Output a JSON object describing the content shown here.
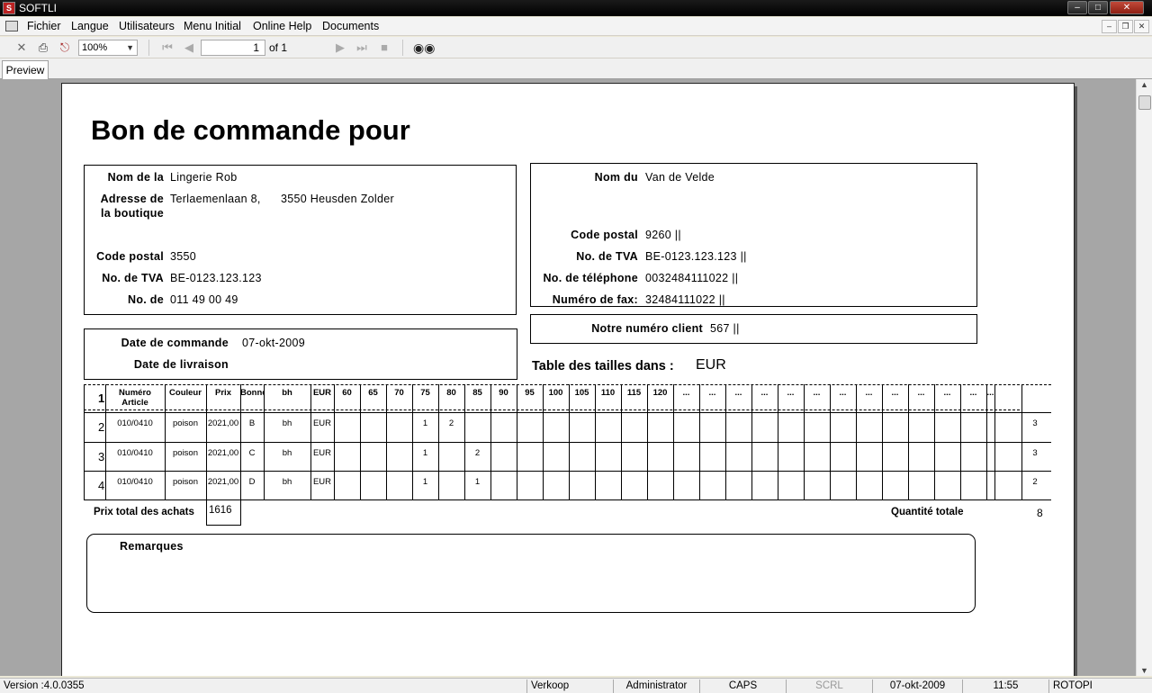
{
  "window": {
    "title": "SOFTLI",
    "app_icon": "S",
    "controls": {
      "minimize": "minimize-icon",
      "maximize": "maximize-icon",
      "close": "close-icon"
    }
  },
  "menubar": {
    "items": [
      "Fichier",
      "Langue",
      "Utilisateurs",
      "Menu Initial",
      "Online Help",
      "Documents"
    ]
  },
  "toolbar": {
    "zoom": "100%",
    "page": "1",
    "of": "of 1",
    "icons": [
      "close-icon",
      "print-icon",
      "export-icon",
      "first-page-icon",
      "prev-page-icon",
      "next-page-icon",
      "last-page-icon",
      "stop-icon",
      "binoculars-icon"
    ]
  },
  "tabs": [
    "Preview"
  ],
  "document": {
    "title": "Bon de commande pour",
    "shop": {
      "name_label": "Nom de la",
      "name": "Lingerie Rob",
      "address_label_1": "Adresse de",
      "address_label_2": "la boutique",
      "address": "Terlaemenlaan 8,",
      "address_city": "3550 Heusden Zolder",
      "postal_label": "Code postal",
      "postal": "3550",
      "vat_label": "No. de TVA",
      "vat": "BE-0123.123.123",
      "phone_label": "No. de",
      "phone": "011 49 00 49"
    },
    "supplier": {
      "name_label": "Nom du",
      "name": "Van de Velde",
      "postal_label": "Code postal",
      "postal": "9260 ||",
      "vat_label": "No. de TVA",
      "vat": "BE-0123.123.123 ||",
      "phone_label": "No. de téléphone",
      "phone": "0032484111022 ||",
      "fax_label": "Numéro de fax:",
      "fax": "32484111022 ||"
    },
    "order": {
      "date_label": "Date de commande",
      "date": "07-okt-2009",
      "delivery_label": "Date de livraison",
      "delivery": ""
    },
    "client": {
      "label": "Notre numéro client",
      "number": "567 ||"
    },
    "sizes_title": "Table des tailles dans :",
    "sizes_unit": "EUR",
    "grid": {
      "header_row_number": "1",
      "headers": [
        "Numéro Article",
        "Couleur",
        "Prix",
        "Bonnet",
        "bh",
        "EUR",
        "60",
        "65",
        "70",
        "75",
        "80",
        "85",
        "90",
        "95",
        "100",
        "105",
        "110",
        "115",
        "120",
        "...",
        "...",
        "...",
        "...",
        "...",
        "...",
        "...",
        "...",
        "...",
        "...",
        "...",
        "...",
        "..."
      ],
      "rows": [
        {
          "num": "2",
          "article": "010/0410",
          "color": "poison",
          "price": "2021,00",
          "cup": "B",
          "type": "bh",
          "unit": "EUR",
          "sizes": {
            "75": "1",
            "80": "2"
          },
          "total": "3"
        },
        {
          "num": "3",
          "article": "010/0410",
          "color": "poison",
          "price": "2021,00",
          "cup": "C",
          "type": "bh",
          "unit": "EUR",
          "sizes": {
            "75": "1",
            "85": "2"
          },
          "total": "3"
        },
        {
          "num": "4",
          "article": "010/0410",
          "color": "poison",
          "price": "2021,00",
          "cup": "D",
          "type": "bh",
          "unit": "EUR",
          "sizes": {
            "75": "1",
            "85": "1"
          },
          "total": "2"
        }
      ]
    },
    "totals": {
      "price_label": "Prix total des achats",
      "price": "1616",
      "qty_label": "Quantité totale",
      "qty": "8"
    },
    "remarks_label": "Remarques"
  },
  "statusbar": {
    "version": "Version :4.0.0355",
    "mode": "Verkoop",
    "user": "Administrator",
    "caps": "CAPS",
    "scrl": "SCRL",
    "date": "07-okt-2009",
    "time": "11:55",
    "host": "ROTOPI"
  }
}
